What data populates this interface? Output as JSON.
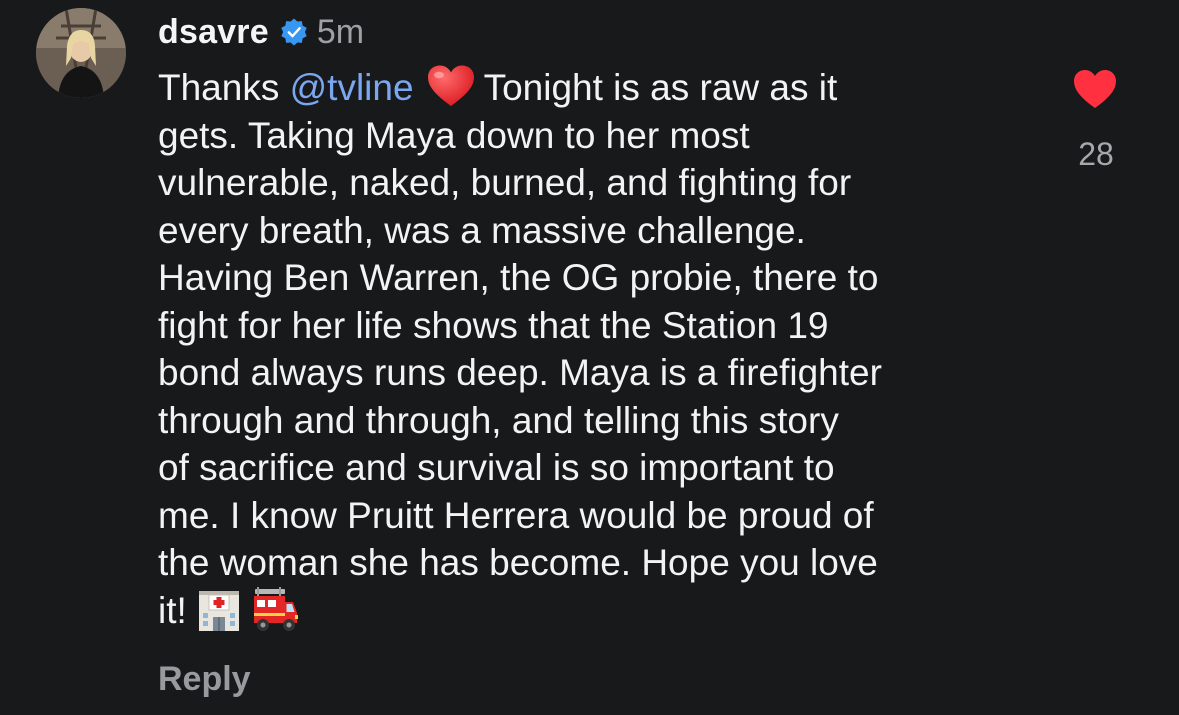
{
  "comment": {
    "username": "dsavre",
    "timestamp": "5m",
    "verified_icon": "verified-badge-icon",
    "lines": [
      {
        "before": "Thanks ",
        "mention": "@tvline",
        "emoji": "red-heart-emoji",
        "after": "Tonight is as raw as it"
      },
      "gets. Taking Maya down to her most",
      "vulnerable, naked, burned, and fighting for",
      "every breath, was a massive challenge.",
      "Having Ben Warren, the OG probie, there to",
      "fight for her life shows that the Station 19",
      "bond always runs deep. Maya is a firefighter",
      "through and through, and telling this story",
      "of sacrifice and survival is so important to",
      "me. I know Pruitt Herrera would be proud of",
      "the woman she has become. Hope you love",
      {
        "text": "it!",
        "emojis": [
          "hospital-emoji",
          "fire-engine-emoji"
        ]
      }
    ],
    "like_count": "28",
    "like_icon": "filled-heart-icon",
    "reply_label": "Reply",
    "colors": {
      "background": "#18191b",
      "mention": "#7aa7f0",
      "like_heart": "#ff3040",
      "verified": "#3897f0"
    }
  }
}
